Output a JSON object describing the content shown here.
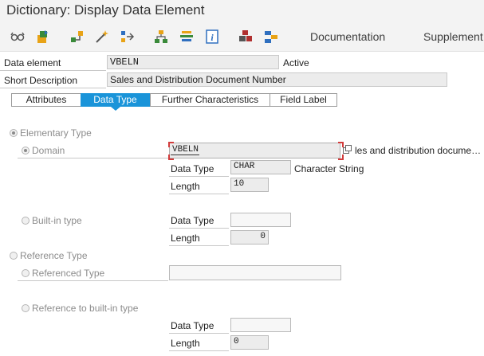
{
  "window": {
    "title": "Dictionary: Display Data Element"
  },
  "toolbar": {
    "icons": [
      "glasses-icon",
      "display-change-icon",
      "where-used-icon",
      "magic-wand-icon",
      "navigate-icon",
      "hierarchy-icon",
      "stack-icon",
      "info-icon",
      "object-list-icon",
      "graph-icon"
    ],
    "documentation_label": "Documentation",
    "supplement_label": "Supplement"
  },
  "header": {
    "data_element_label": "Data element",
    "data_element_value": "VBELN",
    "status": "Active",
    "short_description_label": "Short Description",
    "short_description_value": "Sales and Distribution Document Number"
  },
  "tabs": [
    {
      "label": "Attributes",
      "active": false
    },
    {
      "label": "Data Type",
      "active": true
    },
    {
      "label": "Further Characteristics",
      "active": false
    },
    {
      "label": "Field Label",
      "active": false
    }
  ],
  "data_type": {
    "elementary_type_label": "Elementary Type",
    "domain_label": "Domain",
    "domain_value": "VBELN",
    "domain_description": "les and distribution docume…",
    "domain_data_type_label": "Data Type",
    "domain_data_type_value": "CHAR",
    "domain_data_type_desc": "Character String",
    "domain_length_label": "Length",
    "domain_length_value": "10",
    "builtin_type_label": "Built-in type",
    "builtin_data_type_label": "Data Type",
    "builtin_data_type_value": "",
    "builtin_length_label": "Length",
    "builtin_length_value": "0",
    "reference_type_label": "Reference Type",
    "referenced_type_label": "Referenced Type",
    "referenced_type_value": "",
    "ref_builtin_label": "Reference to built-in type",
    "ref_data_type_label": "Data Type",
    "ref_data_type_value": "",
    "ref_length_label": "Length",
    "ref_length_value": "0"
  },
  "colors": {
    "active_tab": "#1a94d9",
    "background": "#ffffff"
  }
}
